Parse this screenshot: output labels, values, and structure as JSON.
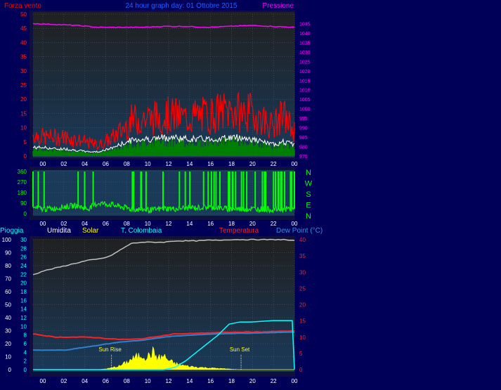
{
  "header": {
    "left_label": "Forza vento",
    "title": "24 hour graph day: 01 Ottobre 2015",
    "right_label": "Pressione"
  },
  "compass": [
    "N",
    "W",
    "S",
    "E",
    "N"
  ],
  "lower_header": {
    "rain": "Pioggia",
    "humidity": "Umidita",
    "solar": "Solar",
    "location": "T. Colombaia",
    "temperature": "Temperatura",
    "dewpoint": "Dew Point (°C)"
  },
  "annotations": {
    "sunrise": "Sun Rise",
    "sunset": "Sun Set"
  },
  "colors": {
    "wind_gust": "#ff0000",
    "wind_avg": "#ffffff",
    "wind_bar": "#008000",
    "pressure": "#ff00ff",
    "direction": "#00ff00",
    "humidity": "#c0c0c0",
    "temperature": "#ff2020",
    "dewpoint": "#3080d0",
    "rain": "#00ffff",
    "solar": "#ffff00"
  },
  "chart_data": [
    {
      "type": "line",
      "x_ticks": [
        "00",
        "02",
        "04",
        "06",
        "08",
        "10",
        "12",
        "14",
        "16",
        "18",
        "20",
        "22",
        "00"
      ],
      "y_left": {
        "label": "Forza vento",
        "ticks": [
          "0",
          "5",
          "10",
          "15",
          "20",
          "25",
          "30",
          "35",
          "40",
          "45",
          "50"
        ],
        "range": [
          0,
          50
        ]
      },
      "y_right": {
        "label": "Pressione",
        "ticks": [
          "975",
          "980",
          "985",
          "990",
          "995",
          "1000",
          "1005",
          "1010",
          "1015",
          "1020",
          "1025",
          "1030",
          "1035",
          "1040",
          "1045"
        ],
        "range": [
          975,
          1050
        ]
      },
      "grid": true,
      "series": [
        {
          "name": "gust",
          "axis": "left",
          "hours": [
            0,
            1,
            2,
            3,
            4,
            5,
            6,
            7,
            8,
            9,
            10,
            11,
            12,
            13,
            14,
            15,
            16,
            17,
            18,
            19,
            20,
            21,
            22,
            23,
            24
          ],
          "values": [
            8,
            7,
            7,
            7,
            6,
            5,
            4,
            6,
            9,
            13,
            14,
            14,
            15,
            15,
            14,
            15,
            15,
            16,
            17,
            16,
            16,
            14,
            11,
            15,
            9
          ]
        },
        {
          "name": "average",
          "axis": "left",
          "hours": [
            0,
            1,
            2,
            3,
            4,
            5,
            6,
            7,
            8,
            9,
            10,
            11,
            12,
            13,
            14,
            15,
            16,
            17,
            18,
            19,
            20,
            21,
            22,
            23,
            24
          ],
          "values": [
            3,
            3,
            2.5,
            2.5,
            2,
            1.5,
            1.5,
            2.5,
            4,
            5.5,
            6,
            6,
            6.5,
            6.5,
            6,
            6,
            6,
            6,
            6.5,
            6.5,
            6,
            5,
            4,
            5,
            4
          ]
        },
        {
          "name": "pressure",
          "axis": "right",
          "hours": [
            0,
            2,
            4,
            6,
            8,
            10,
            12,
            14,
            16,
            18,
            20,
            22,
            24
          ],
          "values": [
            1045,
            1044.5,
            1044,
            1043,
            1043,
            1043,
            1043.5,
            1043.5,
            1043,
            1043.5,
            1044,
            1043.5,
            1043
          ]
        }
      ]
    },
    {
      "type": "scatter",
      "x_ticks": [
        "00",
        "02",
        "04",
        "06",
        "08",
        "10",
        "12",
        "14",
        "16",
        "18",
        "20",
        "22",
        "00"
      ],
      "y_left": {
        "ticks": [
          "0",
          "90",
          "180",
          "270",
          "360"
        ],
        "range": [
          0,
          360
        ]
      },
      "series": [
        {
          "name": "direction",
          "hours": [
            0,
            1,
            2,
            3,
            4,
            5,
            6,
            7,
            8,
            9,
            10,
            11,
            12,
            13,
            14,
            15,
            16,
            17,
            18,
            19,
            20,
            21,
            22,
            23,
            24
          ],
          "values": [
            50,
            40,
            45,
            60,
            70,
            40,
            90,
            80,
            60,
            40,
            35,
            30,
            45,
            40,
            50,
            50,
            55,
            50,
            40,
            40,
            40,
            40,
            35,
            40,
            40
          ]
        }
      ]
    },
    {
      "type": "line",
      "x_ticks": [
        "00",
        "02",
        "04",
        "06",
        "08",
        "10",
        "12",
        "14",
        "16",
        "18",
        "20",
        "22",
        "00"
      ],
      "y_left_humidity": {
        "label": "Umidita",
        "ticks": [
          "0",
          "10",
          "20",
          "30",
          "40",
          "50",
          "60",
          "70",
          "80",
          "90",
          "100"
        ],
        "range": [
          0,
          100
        ]
      },
      "y_left_rain": {
        "label": "Pioggia",
        "ticks": [
          "0",
          "2",
          "4",
          "6",
          "8",
          "10",
          "12",
          "14",
          "16",
          "18",
          "20",
          "22",
          "24",
          "26",
          "28",
          "30"
        ],
        "range": [
          0,
          30
        ]
      },
      "y_right": {
        "label": "Temperatura",
        "ticks": [
          "0",
          "5",
          "10",
          "15",
          "20",
          "25",
          "30",
          "35",
          "40"
        ],
        "range": [
          0,
          40
        ]
      },
      "grid": true,
      "series": [
        {
          "name": "humidity",
          "axis": "humidity",
          "hours": [
            0,
            1,
            2,
            3,
            4,
            5,
            6,
            7,
            8,
            9,
            10,
            11,
            12,
            13,
            14,
            15,
            16,
            17,
            18,
            19,
            20,
            21,
            22,
            23,
            24
          ],
          "values": [
            73,
            76,
            78,
            80,
            82,
            84,
            85,
            87,
            92,
            97,
            98,
            98,
            98,
            99,
            99,
            99,
            99.5,
            99.5,
            100,
            100,
            100,
            100,
            100,
            100,
            99
          ]
        },
        {
          "name": "temperature",
          "axis": "right",
          "hours": [
            0,
            1,
            2,
            3,
            4,
            5,
            6,
            7,
            8,
            9,
            10,
            11,
            12,
            13,
            14,
            15,
            16,
            17,
            18,
            19,
            20,
            21,
            22,
            23,
            24
          ],
          "values": [
            11,
            10.5,
            10,
            10,
            10,
            10,
            9.8,
            9.5,
            9.3,
            9.3,
            9.5,
            10,
            10.5,
            11,
            11,
            11.2,
            11.3,
            11.4,
            11.5,
            11.5,
            11.6,
            11.6,
            11.7,
            11.8,
            11.9
          ]
        },
        {
          "name": "dewpoint",
          "axis": "right",
          "hours": [
            0,
            1,
            2,
            3,
            4,
            5,
            6,
            7,
            8,
            9,
            10,
            11,
            12,
            13,
            14,
            15,
            16,
            17,
            18,
            19,
            20,
            21,
            22,
            23,
            24
          ],
          "values": [
            6,
            6,
            6,
            6,
            6.5,
            7,
            7.5,
            8,
            8.5,
            8.8,
            9,
            9.5,
            10,
            10.3,
            10.5,
            10.7,
            10.9,
            11,
            11.1,
            11.2,
            11.2,
            11.3,
            11.4,
            11.5,
            11.5
          ]
        },
        {
          "name": "rain",
          "axis": "rain",
          "hours": [
            0,
            6,
            8,
            10,
            12,
            13,
            14,
            15,
            16,
            17,
            18,
            19,
            20,
            22,
            23.8,
            24
          ],
          "values": [
            0,
            0,
            0,
            0,
            0,
            0.5,
            2,
            4,
            6,
            8,
            10.5,
            11,
            11,
            11.3,
            11.3,
            0
          ]
        },
        {
          "name": "solar",
          "axis": "humidity",
          "hours": [
            0,
            6,
            7,
            8,
            9,
            10,
            10.5,
            11,
            11.5,
            12,
            12.5,
            13,
            14,
            15,
            16,
            17,
            18,
            19,
            24
          ],
          "values": [
            0,
            0,
            1,
            3,
            8,
            12,
            10,
            14,
            9,
            11,
            7,
            5,
            3,
            2,
            1.5,
            1,
            0.5,
            0,
            0
          ]
        }
      ],
      "markers": [
        {
          "label": "Sun Rise",
          "hour": 7.2
        },
        {
          "label": "Sun Set",
          "hour": 19.1
        }
      ]
    }
  ]
}
